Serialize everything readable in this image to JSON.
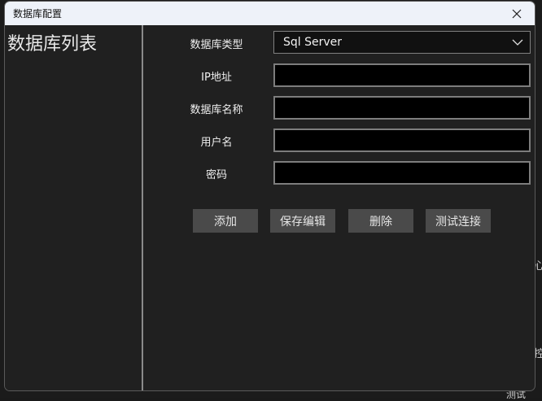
{
  "window": {
    "title": "数据库配置"
  },
  "sidebar": {
    "title": "数据库列表"
  },
  "form": {
    "db_type_label": "数据库类型",
    "db_type_value": "Sql Server",
    "ip_label": "IP地址",
    "ip_value": "",
    "db_name_label": "数据库名称",
    "db_name_value": "",
    "username_label": "用户名",
    "username_value": "",
    "password_label": "密码",
    "password_value": ""
  },
  "buttons": {
    "add": "添加",
    "save_edit": "保存编辑",
    "delete": "删除",
    "test_connection": "测试连接"
  },
  "background": {
    "frag_1": "心",
    "frag_2": "控",
    "frag_3": "测试"
  }
}
